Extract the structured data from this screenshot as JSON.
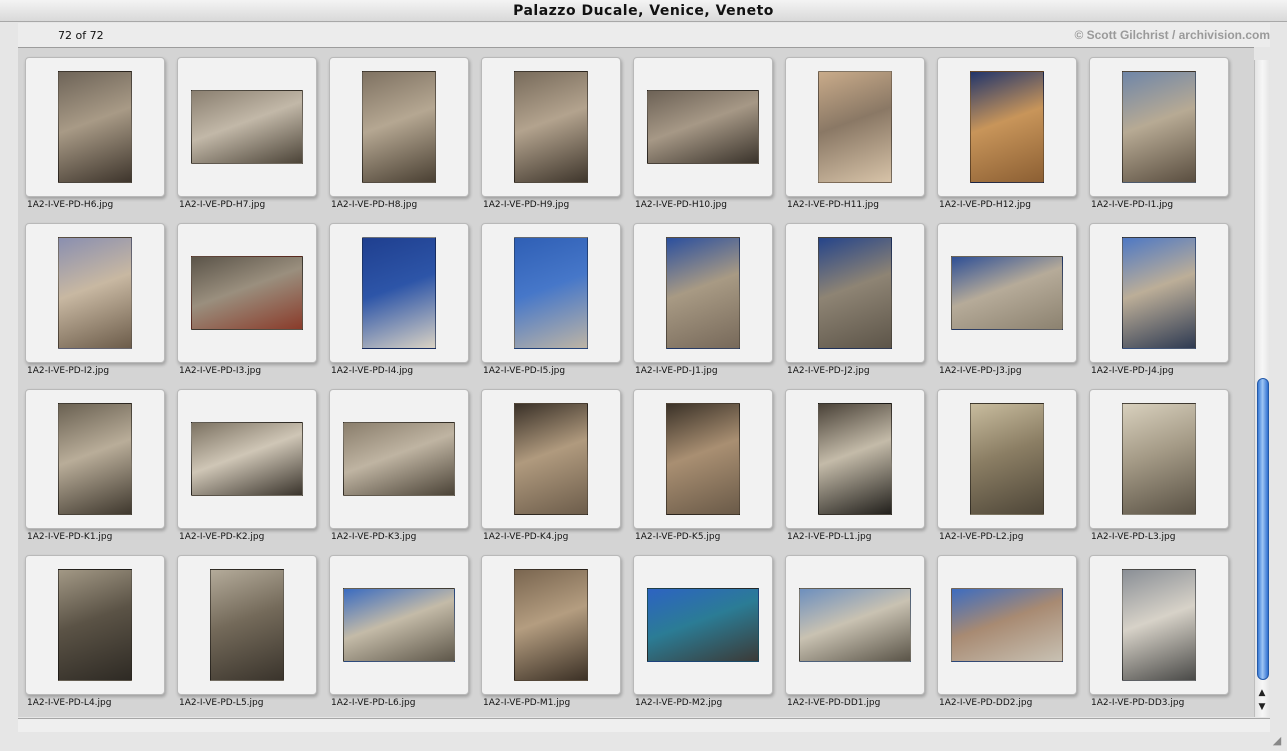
{
  "window": {
    "title": "Palazzo Ducale, Venice, Veneto"
  },
  "status": {
    "count": "72 of 72",
    "credit": "© Scott Gilchrist / archivision.com"
  },
  "thumbnails": [
    {
      "filename": "1A2-I-VE-PD-H6.jpg",
      "orientation": "portrait",
      "colors": [
        "#6e6458",
        "#a89a86",
        "#3e352c"
      ]
    },
    {
      "filename": "1A2-I-VE-PD-H7.jpg",
      "orientation": "landscape",
      "colors": [
        "#8a7f70",
        "#c2b8a8",
        "#4c4438"
      ]
    },
    {
      "filename": "1A2-I-VE-PD-H8.jpg",
      "orientation": "portrait",
      "colors": [
        "#7f7262",
        "#b5a792",
        "#4a4033"
      ]
    },
    {
      "filename": "1A2-I-VE-PD-H9.jpg",
      "orientation": "portrait",
      "colors": [
        "#786b5b",
        "#b3a38e",
        "#3f362c"
      ]
    },
    {
      "filename": "1A2-I-VE-PD-H10.jpg",
      "orientation": "landscape",
      "colors": [
        "#6d6256",
        "#a69886",
        "#3a332b"
      ]
    },
    {
      "filename": "1A2-I-VE-PD-H11.jpg",
      "orientation": "portrait",
      "colors": [
        "#c9ab8a",
        "#8a7865",
        "#d7c3a8"
      ]
    },
    {
      "filename": "1A2-I-VE-PD-H12.jpg",
      "orientation": "portrait",
      "colors": [
        "#22356b",
        "#c8955a",
        "#8c5f33"
      ]
    },
    {
      "filename": "1A2-I-VE-PD-I1.jpg",
      "orientation": "portrait",
      "colors": [
        "#6f86a8",
        "#b7aa94",
        "#5a4e40"
      ]
    },
    {
      "filename": "1A2-I-VE-PD-I2.jpg",
      "orientation": "portrait",
      "colors": [
        "#8a8fb0",
        "#c8b8a2",
        "#6c5c4a"
      ]
    },
    {
      "filename": "1A2-I-VE-PD-I3.jpg",
      "orientation": "landscape",
      "colors": [
        "#5b5449",
        "#9a8f7e",
        "#8a3b2a"
      ]
    },
    {
      "filename": "1A2-I-VE-PD-I4.jpg",
      "orientation": "portrait",
      "colors": [
        "#1f3f8f",
        "#2d55a8",
        "#d9d2c4"
      ]
    },
    {
      "filename": "1A2-I-VE-PD-I5.jpg",
      "orientation": "portrait",
      "colors": [
        "#2f5fb5",
        "#4677c9",
        "#bdb4a5"
      ]
    },
    {
      "filename": "1A2-I-VE-PD-J1.jpg",
      "orientation": "portrait",
      "colors": [
        "#2b4f9e",
        "#a89a84",
        "#77695a"
      ]
    },
    {
      "filename": "1A2-I-VE-PD-J2.jpg",
      "orientation": "portrait",
      "colors": [
        "#25448a",
        "#8e8474",
        "#5d5549"
      ]
    },
    {
      "filename": "1A2-I-VE-PD-J3.jpg",
      "orientation": "landscape",
      "colors": [
        "#2e4f96",
        "#b6ab99",
        "#8c8270"
      ]
    },
    {
      "filename": "1A2-I-VE-PD-J4.jpg",
      "orientation": "portrait",
      "colors": [
        "#4e78c4",
        "#bcae98",
        "#2e3a52"
      ]
    },
    {
      "filename": "1A2-I-VE-PD-K1.jpg",
      "orientation": "portrait",
      "colors": [
        "#6a6152",
        "#b9ad99",
        "#3f382e"
      ]
    },
    {
      "filename": "1A2-I-VE-PD-K2.jpg",
      "orientation": "landscape",
      "colors": [
        "#7c7262",
        "#cfc6b6",
        "#3a342c"
      ]
    },
    {
      "filename": "1A2-I-VE-PD-K3.jpg",
      "orientation": "landscape",
      "colors": [
        "#8a7e6c",
        "#bfb4a2",
        "#4b4337"
      ]
    },
    {
      "filename": "1A2-I-VE-PD-K4.jpg",
      "orientation": "portrait",
      "colors": [
        "#3a3128",
        "#b09a7e",
        "#6d5d4b"
      ]
    },
    {
      "filename": "1A2-I-VE-PD-K5.jpg",
      "orientation": "portrait",
      "colors": [
        "#3b3228",
        "#a98f72",
        "#6a5a48"
      ]
    },
    {
      "filename": "1A2-I-VE-PD-L1.jpg",
      "orientation": "portrait",
      "colors": [
        "#4a4238",
        "#c4bba9",
        "#22201c"
      ]
    },
    {
      "filename": "1A2-I-VE-PD-L2.jpg",
      "orientation": "portrait",
      "colors": [
        "#c8bc9e",
        "#8b7e64",
        "#4e4638"
      ]
    },
    {
      "filename": "1A2-I-VE-PD-L3.jpg",
      "orientation": "portrait",
      "colors": [
        "#d8d0bd",
        "#a49a86",
        "#5a5245"
      ]
    },
    {
      "filename": "1A2-I-VE-PD-L4.jpg",
      "orientation": "portrait",
      "colors": [
        "#a29885",
        "#5b5346",
        "#2e2a24"
      ]
    },
    {
      "filename": "1A2-I-VE-PD-L5.jpg",
      "orientation": "portrait",
      "colors": [
        "#b4ab9a",
        "#746a5a",
        "#3a342c"
      ]
    },
    {
      "filename": "1A2-I-VE-PD-L6.jpg",
      "orientation": "landscape",
      "colors": [
        "#3a6bc0",
        "#c4bba8",
        "#5e574a"
      ]
    },
    {
      "filename": "1A2-I-VE-PD-M1.jpg",
      "orientation": "portrait",
      "colors": [
        "#7a6650",
        "#b49d80",
        "#3c3126"
      ]
    },
    {
      "filename": "1A2-I-VE-PD-M2.jpg",
      "orientation": "landscape",
      "colors": [
        "#2d63c2",
        "#2b7c95",
        "#3b3a37"
      ]
    },
    {
      "filename": "1A2-I-VE-PD-DD1.jpg",
      "orientation": "landscape",
      "colors": [
        "#6d8fbe",
        "#c9c2b2",
        "#5a5448"
      ]
    },
    {
      "filename": "1A2-I-VE-PD-DD2.jpg",
      "orientation": "landscape",
      "colors": [
        "#3d6cc0",
        "#a88a72",
        "#c8c1b3"
      ]
    },
    {
      "filename": "1A2-I-VE-PD-DD3.jpg",
      "orientation": "portrait",
      "colors": [
        "#8a8f96",
        "#d7d2c8",
        "#4a4a48"
      ]
    }
  ],
  "scroll": {
    "up_arrow": "▲",
    "down_arrow": "▼"
  }
}
